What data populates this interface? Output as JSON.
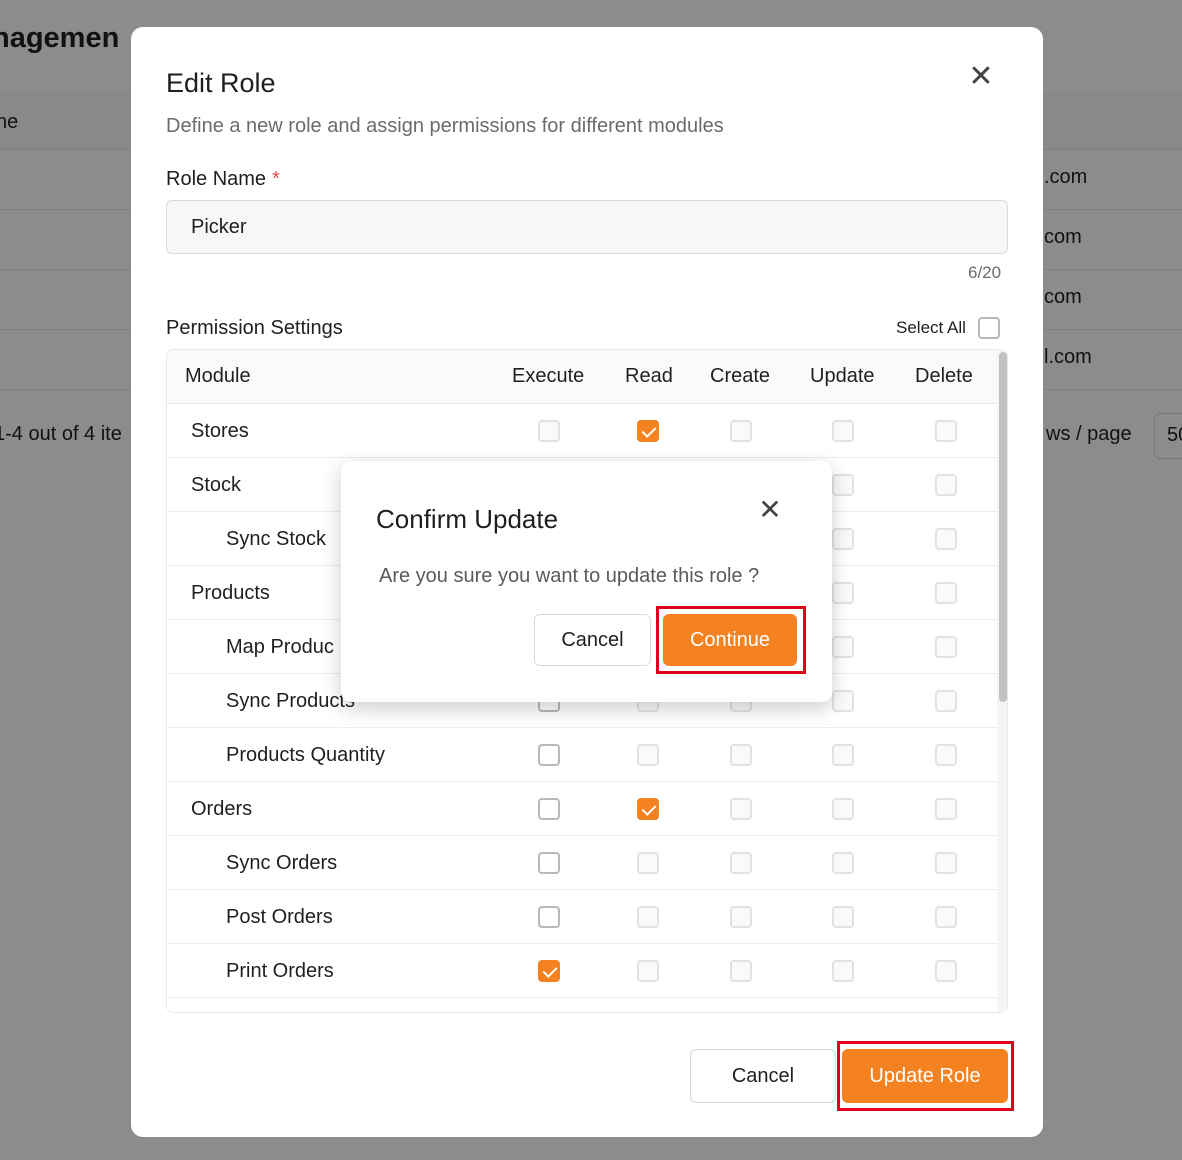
{
  "background": {
    "page_title_fragment": "nagemen",
    "header_fragment": "ne",
    "email_fragments": [
      ".com",
      "com",
      "com",
      "l.com"
    ],
    "pagination_left": "1-4 out of 4 ite",
    "pagination_right": "ws / page",
    "page_size_fragment": "50"
  },
  "edit_modal": {
    "title": "Edit Role",
    "subtitle": "Define a new role and assign permissions for different modules",
    "role_name_label": "Role Name",
    "required_mark": "*",
    "role_name_value": "Picker",
    "char_count": "6/20",
    "permission_settings_label": "Permission Settings",
    "select_all_label": "Select All",
    "columns": [
      "Module",
      "Execute",
      "Read",
      "Create",
      "Update",
      "Delete"
    ],
    "rows": [
      {
        "label": "Stores",
        "indent": false,
        "execute": "disabled",
        "read": "checked",
        "create": "disabled",
        "update": "disabled",
        "delete": "disabled"
      },
      {
        "label": "Stock",
        "indent": false,
        "execute": "disabled",
        "read": "disabled",
        "create": "disabled",
        "update": "disabled",
        "delete": "disabled"
      },
      {
        "label": "Sync Stock",
        "indent": true,
        "execute": "disabled",
        "read": "disabled",
        "create": "disabled",
        "update": "disabled",
        "delete": "disabled"
      },
      {
        "label": "Products",
        "indent": false,
        "execute": "disabled",
        "read": "disabled",
        "create": "disabled",
        "update": "disabled",
        "delete": "disabled"
      },
      {
        "label": "Map Produc",
        "indent": true,
        "execute": "disabled",
        "read": "disabled",
        "create": "disabled",
        "update": "disabled",
        "delete": "disabled"
      },
      {
        "label": "Sync Products",
        "indent": true,
        "execute": "enabled",
        "read": "disabled",
        "create": "disabled",
        "update": "disabled",
        "delete": "disabled"
      },
      {
        "label": "Products Quantity",
        "indent": true,
        "execute": "enabled",
        "read": "disabled",
        "create": "disabled",
        "update": "disabled",
        "delete": "disabled"
      },
      {
        "label": "Orders",
        "indent": false,
        "execute": "enabled",
        "read": "checked",
        "create": "disabled",
        "update": "disabled",
        "delete": "disabled"
      },
      {
        "label": "Sync Orders",
        "indent": true,
        "execute": "enabled",
        "read": "disabled",
        "create": "disabled",
        "update": "disabled",
        "delete": "disabled"
      },
      {
        "label": "Post Orders",
        "indent": true,
        "execute": "enabled",
        "read": "disabled",
        "create": "disabled",
        "update": "disabled",
        "delete": "disabled"
      },
      {
        "label": "Print Orders",
        "indent": true,
        "execute": "checked",
        "read": "disabled",
        "create": "disabled",
        "update": "disabled",
        "delete": "disabled"
      }
    ],
    "cancel_label": "Cancel",
    "update_label": "Update Role",
    "close_icon": "close-icon"
  },
  "confirm_modal": {
    "title": "Confirm Update",
    "message": "Are you sure you want to update this role ?",
    "cancel_label": "Cancel",
    "continue_label": "Continue",
    "close_icon": "close-icon"
  },
  "colors": {
    "accent": "#f58220",
    "highlight": "#e0001b"
  }
}
